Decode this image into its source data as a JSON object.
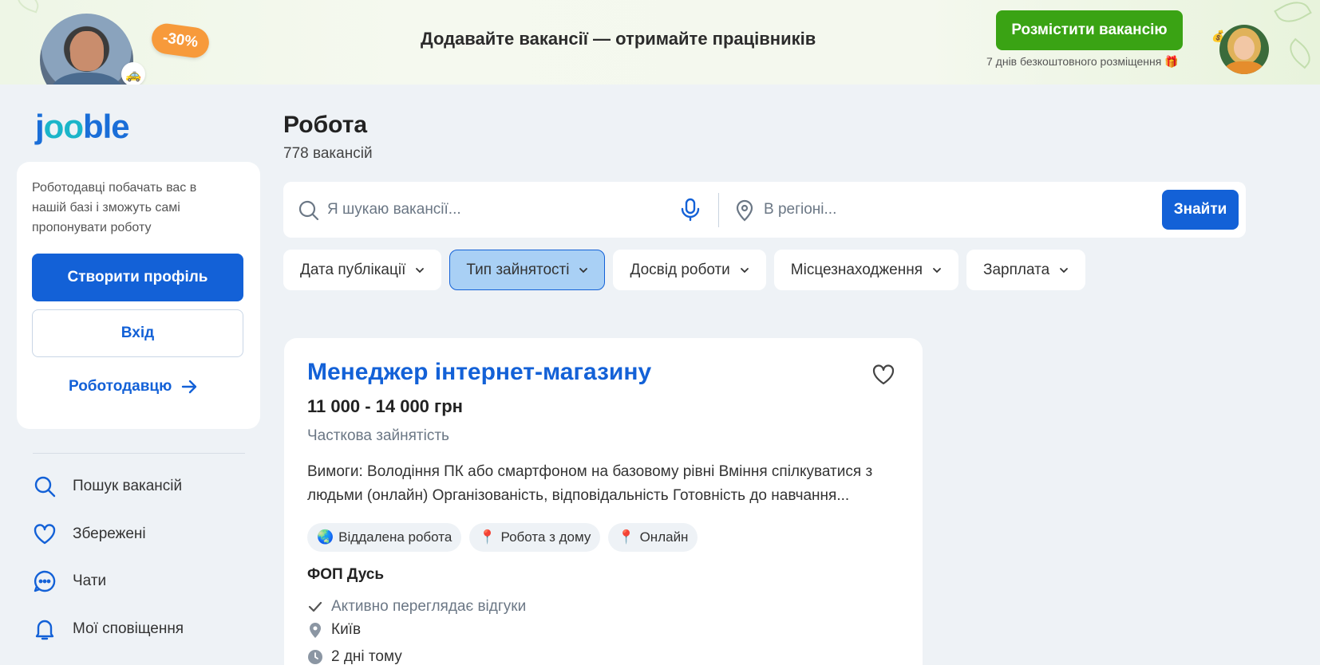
{
  "banner": {
    "discount": "-30%",
    "headline": "Додавайте вакансії — отримайте працівників",
    "post_button": "Розмістити вакансію",
    "post_note": "7 днів безкоштовного розміщення 🎁"
  },
  "sidebar": {
    "logo": {
      "j": "j",
      "oo": "oo",
      "rest": "ble"
    },
    "description": "Роботодавці побачать вас в нашій базі і зможуть самі пропонувати роботу",
    "create_profile": "Створити профіль",
    "login": "Вхід",
    "employer_link": "Роботодавцю",
    "nav": [
      {
        "label": "Пошук вакансій",
        "icon": "search-icon"
      },
      {
        "label": "Збережені",
        "icon": "heart-icon"
      },
      {
        "label": "Чати",
        "icon": "chat-icon"
      },
      {
        "label": "Мої сповіщення",
        "icon": "bell-icon"
      }
    ]
  },
  "main": {
    "title": "Робота",
    "count": "778 вакансій",
    "search": {
      "keyword_placeholder": "Я шукаю вакансії...",
      "region_placeholder": "В регіоні...",
      "button": "Знайти"
    },
    "filters": [
      {
        "label": "Дата публікації",
        "active": false
      },
      {
        "label": "Тип зайнятості",
        "active": true
      },
      {
        "label": "Досвід роботи",
        "active": false
      },
      {
        "label": "Місцезнаходження",
        "active": false
      },
      {
        "label": "Зарплата",
        "active": false
      }
    ]
  },
  "job": {
    "title": "Менеджер інтернет-магазину",
    "salary": "11 000 - 14 000 грн",
    "employment": "Часткова зайнятість",
    "description": "Вимоги: Володіння ПК або смартфоном на базовому рівні Вміння спілкуватися з людьми (онлайн) Організованість, відповідальність Готовність до навчання...",
    "tags": [
      {
        "label": "Віддалена робота",
        "icon": "globe-icon"
      },
      {
        "label": "Робота з дому",
        "icon": "pushpin-icon"
      },
      {
        "label": "Онлайн",
        "icon": "pushpin-icon"
      }
    ],
    "company": "ФОП Дусь",
    "activity": "Активно переглядає відгуки",
    "location": "Київ",
    "posted": "2 дні тому"
  },
  "colors": {
    "primary": "#1361d7",
    "green": "#3aa314",
    "discount": "#f79a3b",
    "filter_active_bg": "#a9d0f5",
    "background": "#eef2f6"
  }
}
